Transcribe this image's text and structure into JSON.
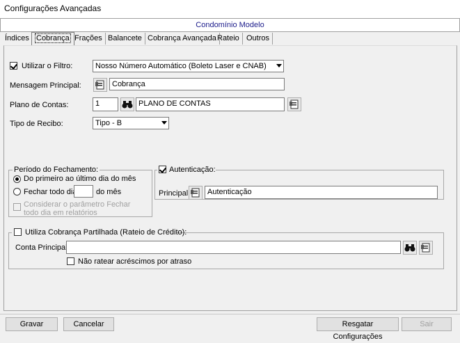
{
  "window": {
    "title": "Configurações Avançadas"
  },
  "banner": "Condomínio Modelo",
  "tabs": [
    "Índices",
    "Cobrança",
    "Frações",
    "Balancete",
    "Cobrança Avançada",
    "Rateio",
    "Outros"
  ],
  "form": {
    "filter_checked": true,
    "filter_label": "Utilizar o Filtro:",
    "filter_value": "Nosso Número Automático (Boleto Laser e CNAB)",
    "main_message_label": "Mensagem Principal:",
    "main_message_value": "Cobrança",
    "chart_accounts_label": "Plano de Contas:",
    "chart_accounts_code": "1",
    "chart_accounts_name": "PLANO DE CONTAS",
    "receipt_type_label": "Tipo de Recibo:",
    "receipt_type_value": "Tipo - B"
  },
  "period_group": {
    "title": "Período do Fechamento:",
    "option_first_to_last": "Do primeiro ao último dia do mês",
    "option_close_every_day_a": "Fechar todo dia",
    "option_close_every_day_b": "do mês",
    "option_close_day_value": "",
    "consider_param": "Considerar o parâmetro Fechar todo dia em relatórios",
    "selected": "first_to_last"
  },
  "auth_group": {
    "title": "Autenticação:",
    "checked": true,
    "principal_label": "Principal:",
    "principal_value": "Autenticação"
  },
  "shared_billing": {
    "title": "Utiliza Cobrança Partilhada (Rateio de Crédito):",
    "checked": false,
    "main_account_label": "Conta Principal:",
    "main_account_value": "",
    "no_apportion_label": "Não ratear acréscimos por atraso"
  },
  "buttons": {
    "save": "Gravar",
    "cancel": "Cancelar",
    "restore": "Resgatar Configurações",
    "exit": "Sair"
  },
  "colors": {
    "banner_text": "#1a1a8a",
    "disabled_text": "#a0a0a0"
  }
}
